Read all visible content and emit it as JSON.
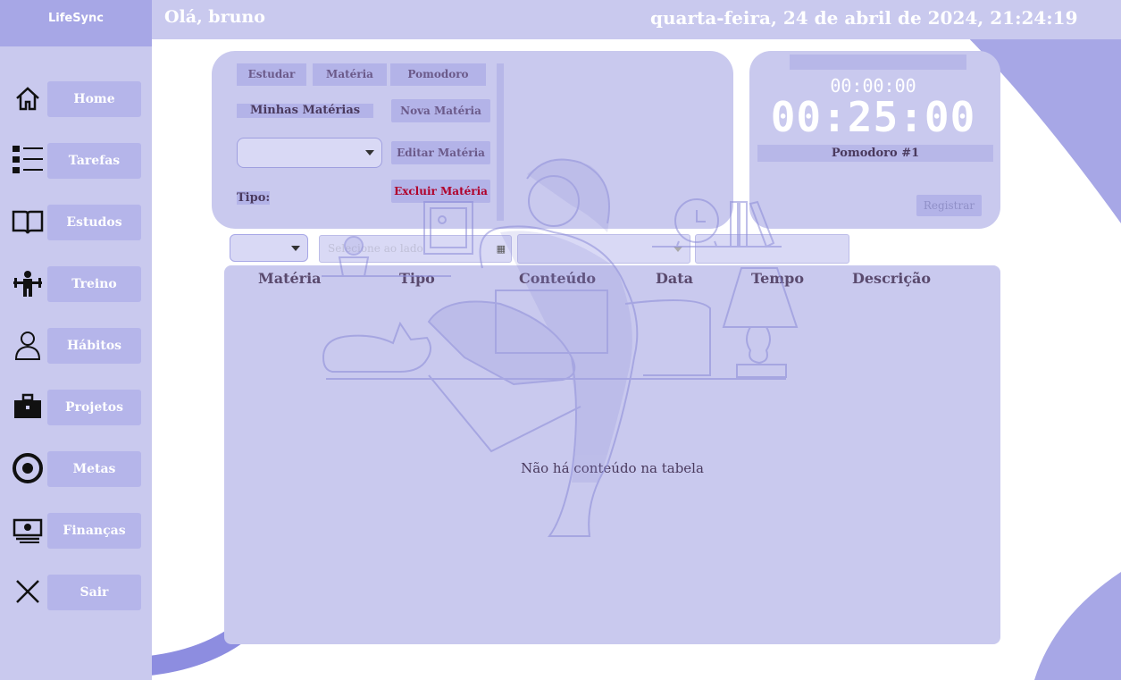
{
  "app": {
    "brand": "LifeSync"
  },
  "header": {
    "greeting": "Olá, bruno",
    "datetime": "quarta-feira, 24 de abril de 2024, 21:24:19"
  },
  "sidebar": {
    "items": [
      {
        "label": "Home",
        "icon": "home-icon"
      },
      {
        "label": "Tarefas",
        "icon": "checklist-icon"
      },
      {
        "label": "Estudos",
        "icon": "book-icon"
      },
      {
        "label": "Treino",
        "icon": "workout-icon"
      },
      {
        "label": "Hábitos",
        "icon": "person-icon"
      },
      {
        "label": "Projetos",
        "icon": "briefcase-icon"
      },
      {
        "label": "Metas",
        "icon": "target-icon"
      },
      {
        "label": "Finanças",
        "icon": "money-icon"
      },
      {
        "label": "Sair",
        "icon": "close-icon"
      }
    ]
  },
  "study": {
    "tabs": [
      "Estudar",
      "Matéria",
      "Pomodoro"
    ],
    "my_subjects_label": "Minhas Matérias",
    "new_subject": "Nova Matéria",
    "edit_subject": "Editar Matéria",
    "delete_subject": "Excluir Matéria",
    "type_label": "Tipo:",
    "subject_select_value": ""
  },
  "timer": {
    "small_time": "00:00:00",
    "big_time": "00:25:00",
    "session_label": "Pomodoro #1",
    "register_button": "Registrar"
  },
  "filters": {
    "date_placeholder": "Selecione ao lado",
    "calendar_icon": "calendar-icon"
  },
  "table": {
    "columns": [
      "Matéria",
      "Tipo",
      "Conteúdo",
      "Data",
      "Tempo",
      "Descrição"
    ],
    "empty_message": "Não há conteúdo na tabela"
  },
  "colors": {
    "panel": "#c9c9ee",
    "accent": "#a7a7e6",
    "button": "#b3b3e8",
    "danger_text": "#b0002a"
  }
}
